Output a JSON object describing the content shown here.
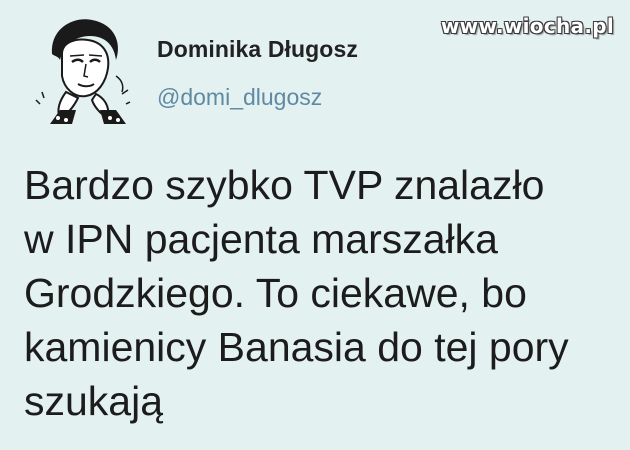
{
  "watermark": "www.wiocha.pl",
  "author": {
    "display_name": "Dominika Długosz",
    "handle": "@domi_dlugosz"
  },
  "tweet": {
    "lines": [
      "Bardzo szybko TVP znalazło",
      "w IPN pacjenta marszałka",
      "Grodzkiego. To ciekawe, bo",
      "kamienicy Banasia do tej pory",
      "szukają"
    ]
  },
  "colors": {
    "background": "#e4f1f1",
    "name": "#222222",
    "handle": "#5f8aa3",
    "body": "#1c1c1c"
  }
}
